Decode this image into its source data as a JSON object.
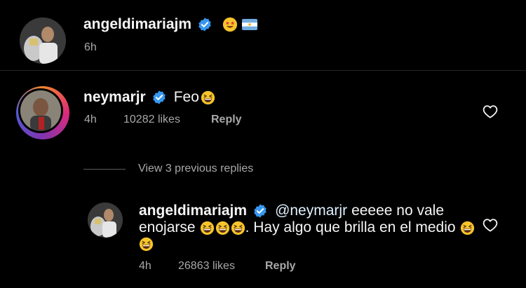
{
  "post": {
    "username": "angeldimariajm",
    "time": "6h"
  },
  "comment": {
    "username": "neymarjr",
    "text": "Feo",
    "time": "4h",
    "likes": "10282 likes",
    "reply_label": "Reply"
  },
  "view_replies": "View 3 previous replies",
  "reply": {
    "username": "angeldimariajm",
    "mention": "@neymarjr",
    "text_line1": "eeeee no vale",
    "text_line2_a": "enojarse",
    "text_line2_b": ". Hay algo que brilla en el medio",
    "time": "4h",
    "likes": "26863 likes",
    "reply_label": "Reply"
  },
  "colors": {
    "background": "#000000",
    "verified": "#3797f0",
    "muted": "#a8a8a8",
    "mention": "#e0f1ff"
  },
  "icons": {
    "verified": "verified-badge-icon",
    "heart": "heart-outline-icon",
    "emoji_star_eyes": "star-struck-emoji",
    "flag": "argentina-flag-emoji",
    "laugh": "grinning-squinting-face-emoji"
  }
}
